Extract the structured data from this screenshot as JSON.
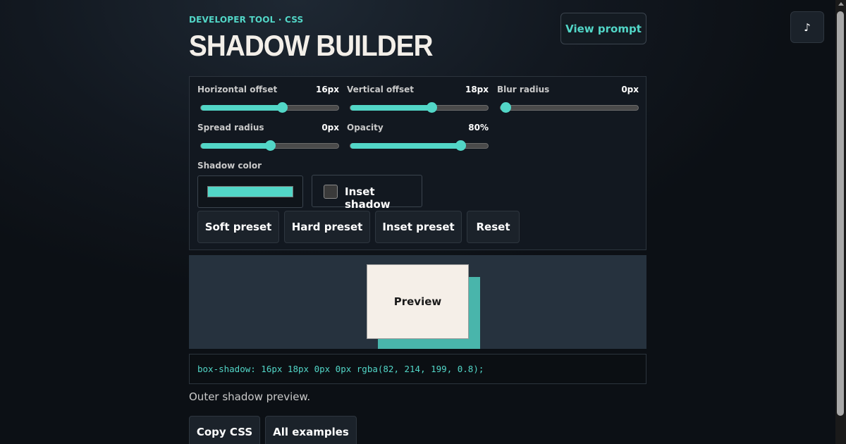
{
  "header": {
    "eyebrow": "DEVELOPER TOOL · CSS",
    "title": "SHADOW BUILDER",
    "view_prompt_label": "View prompt",
    "music_icon": "♪"
  },
  "controls": {
    "sliders": [
      {
        "label": "Horizontal offset",
        "value_text": "16px",
        "fraction": 0.59
      },
      {
        "label": "Vertical offset",
        "value_text": "18px",
        "fraction": 0.59
      },
      {
        "label": "Blur radius",
        "value_text": "0px",
        "fraction": 0.0
      },
      {
        "label": "Spread radius",
        "value_text": "0px",
        "fraction": 0.5
      },
      {
        "label": "Opacity",
        "value_text": "80%",
        "fraction": 0.8
      }
    ],
    "shadow_color_label": "Shadow color",
    "shadow_color": "#52d6c7",
    "inset_label": "Inset shadow",
    "inset_checked": false,
    "presets": [
      "Soft preset",
      "Hard preset",
      "Inset preset",
      "Reset"
    ]
  },
  "preview": {
    "label": "Preview"
  },
  "output": {
    "css": "box-shadow: 16px 18px 0px 0px rgba(82, 214, 199, 0.8);",
    "description": "Outer shadow preview."
  },
  "actions": [
    "Copy CSS",
    "All examples"
  ],
  "colors": {
    "accent": "#52d6c7",
    "background": "#121820",
    "stage": "#26323e",
    "preview_box": "#f5efe8"
  }
}
